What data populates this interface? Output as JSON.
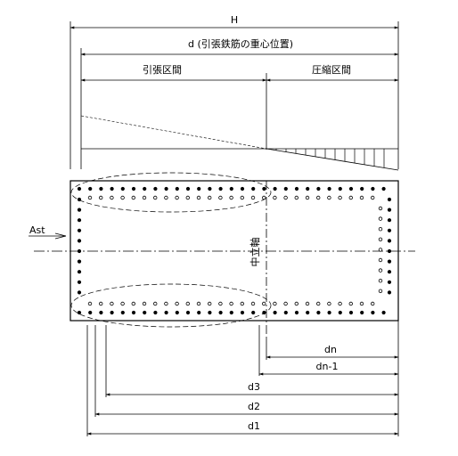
{
  "labels": {
    "H": "H",
    "d": "d (引張鉄筋の重心位置)",
    "tension_zone": "引張区間",
    "compression_zone": "圧縮区間",
    "ast": "Ast",
    "neutral_axis": "中立軸",
    "dn": "dn",
    "dn1": "dn-1",
    "d3": "d3",
    "d2": "d2",
    "d1": "d1"
  },
  "colors": {
    "line": "#000000",
    "background": "#ffffff"
  }
}
